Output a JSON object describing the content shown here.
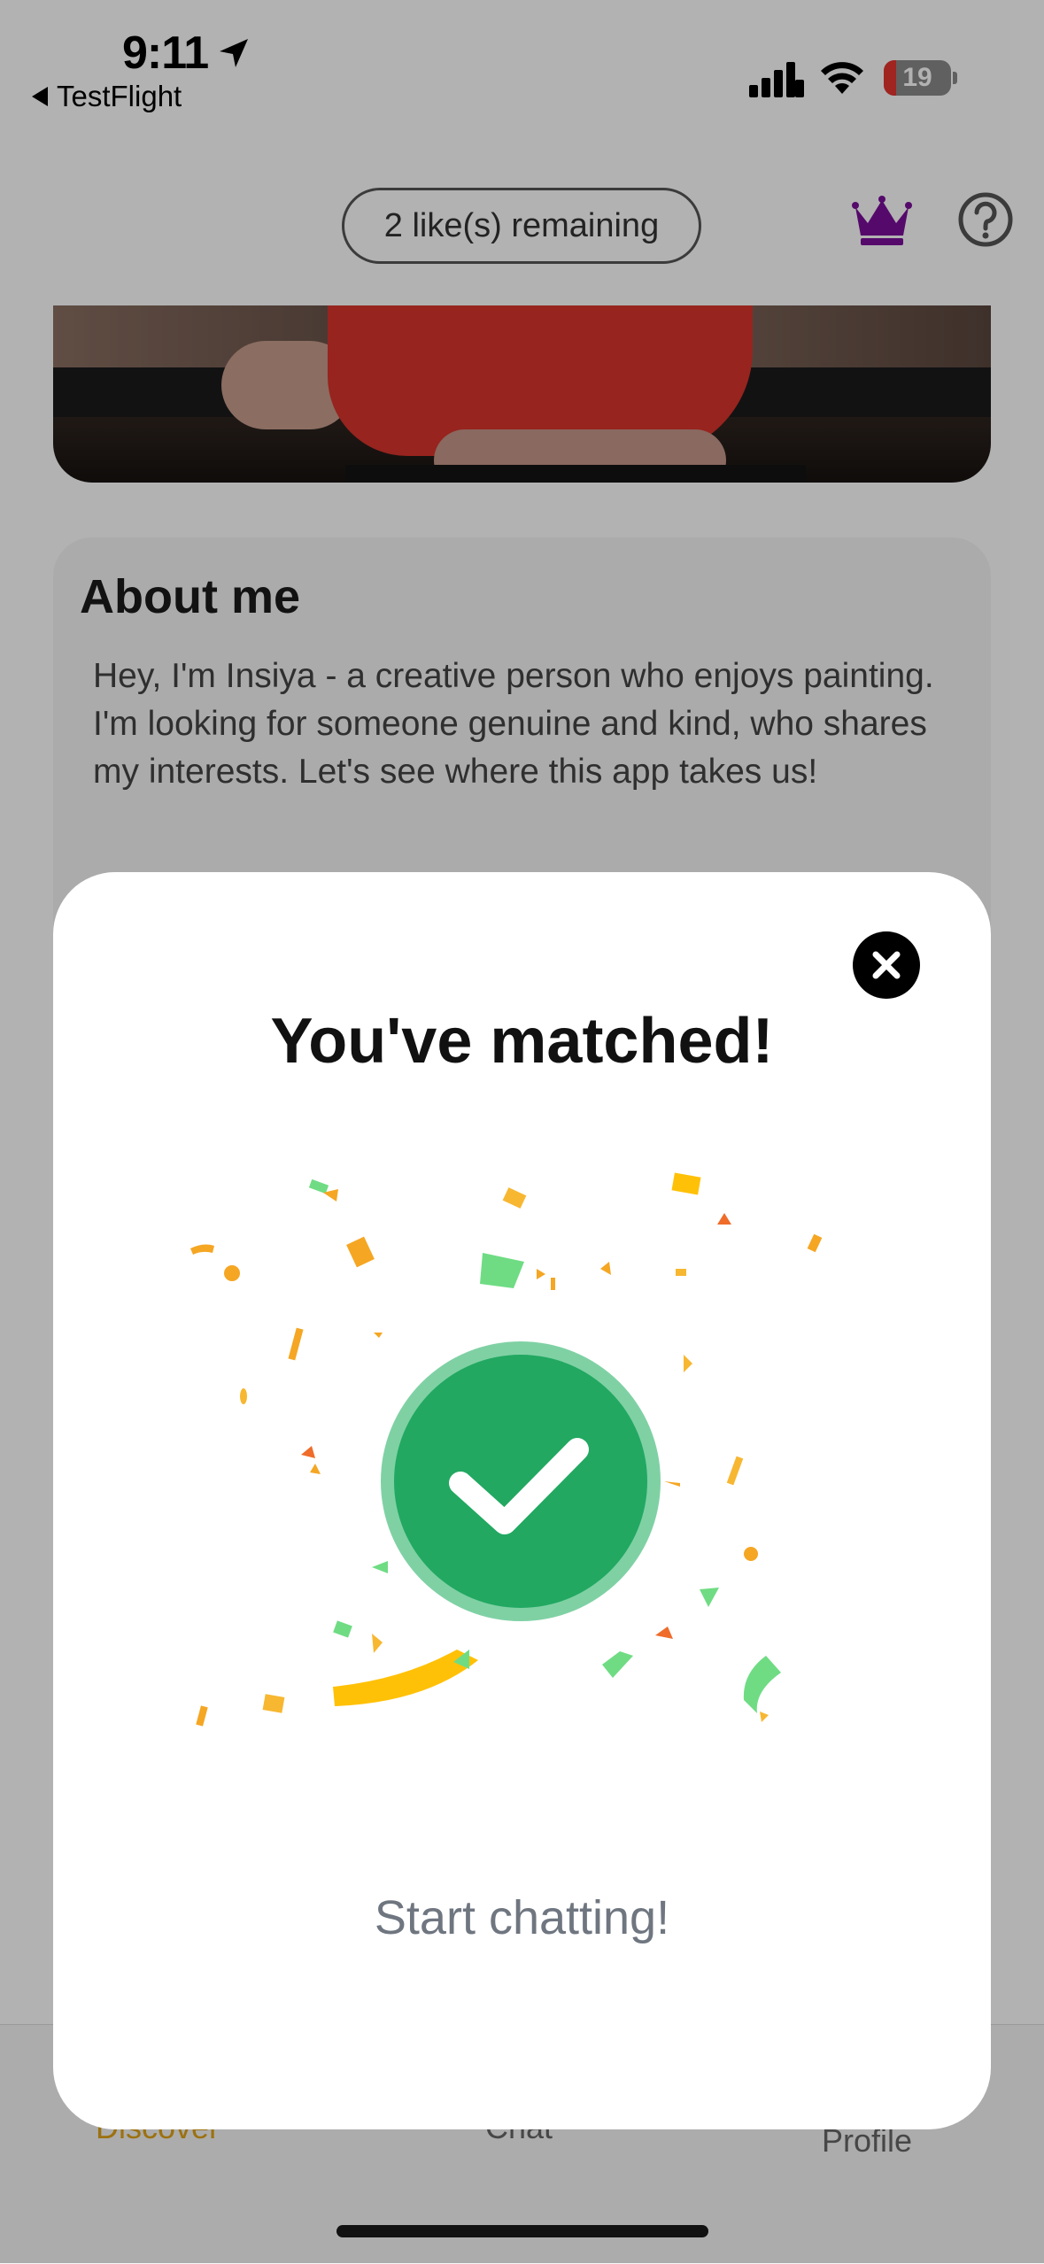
{
  "status_bar": {
    "time": "9:11",
    "back_app_label": "TestFlight",
    "battery_level": "19",
    "icons": [
      "location-arrow-icon",
      "cellular-signal-icon",
      "wifi-icon",
      "battery-icon"
    ]
  },
  "header": {
    "likes_remaining": "2 like(s) remaining",
    "premium_icon": "crown-icon",
    "premium_color": "#7a0f9a",
    "help_icon": "question-circle-icon"
  },
  "profile": {
    "about_title": "About me",
    "about_text": "Hey, I'm Insiya - a creative person who enjoys painting. I'm looking for someone genuine and kind, who shares my interests. Let's see where this app takes us!"
  },
  "tabbar": {
    "tabs": [
      {
        "label": "Discover",
        "active": true
      },
      {
        "label": "Chat",
        "active": false
      },
      {
        "label": "Profile",
        "active": false
      }
    ],
    "active_color": "#e0a316"
  },
  "match_modal": {
    "title": "You've matched!",
    "cta_label": "Start chatting!",
    "close_icon": "close-icon",
    "success_icon": "checkmark-circle-icon",
    "success_color": "#22a861",
    "confetti_colors": [
      "#f5a623",
      "#ffc107",
      "#6fdc84",
      "#ef6c2a",
      "#f7b731"
    ]
  }
}
